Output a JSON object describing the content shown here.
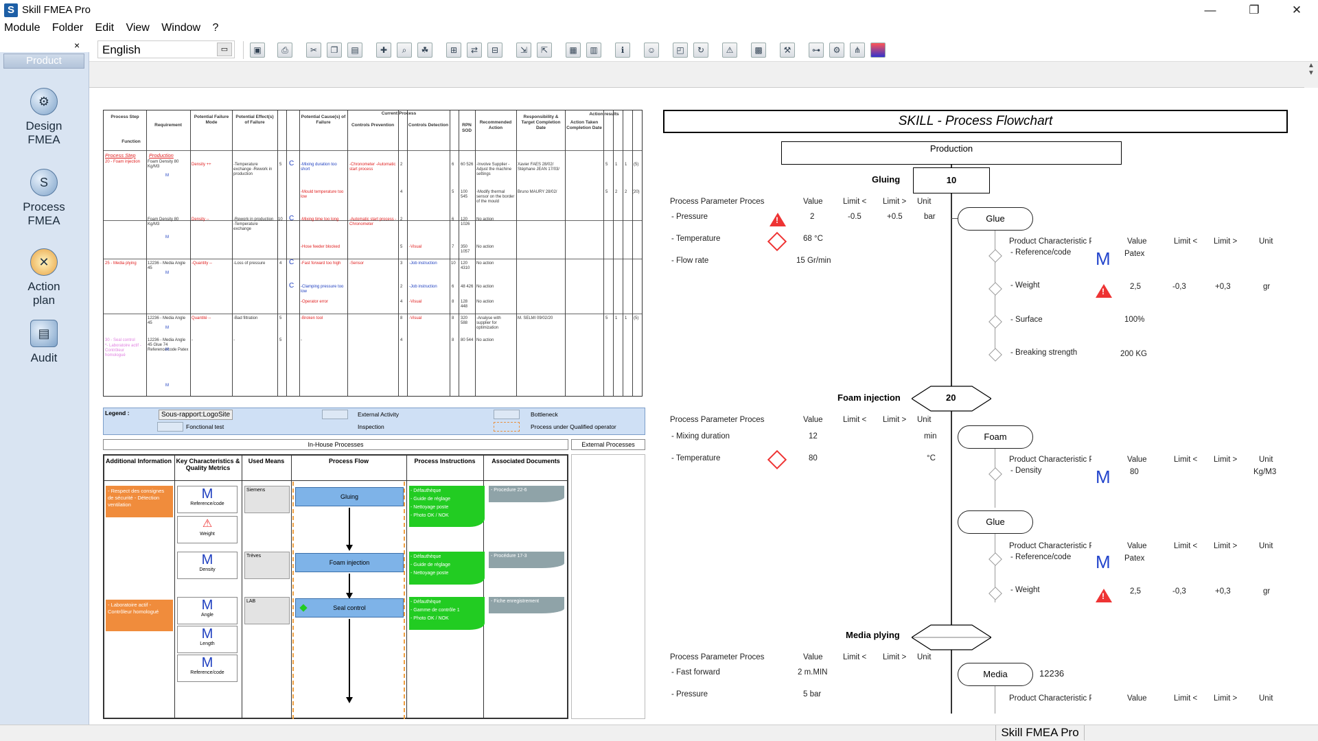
{
  "window": {
    "title": "Skill FMEA Pro",
    "controls": [
      "—",
      "❐",
      "✕"
    ]
  },
  "menu": [
    "Module",
    "Folder",
    "Edit",
    "View",
    "Window",
    "?"
  ],
  "toolbar": {
    "language": "English"
  },
  "leftpanel": {
    "close": "×",
    "tab": "Product",
    "items": [
      {
        "label": "Design",
        "label2": "FMEA"
      },
      {
        "label": "Process",
        "label2": "FMEA"
      },
      {
        "label": "Action",
        "label2": "plan"
      },
      {
        "label": "Audit",
        "label2": ""
      }
    ]
  },
  "status": "Skill FMEA Pro",
  "fmea": {
    "headers": [
      "Process Step",
      "Function",
      "Requirement",
      "Potential Failure Mode",
      "Potential Effect(s) of Failure",
      "Severity",
      "Classification",
      "Potential Cause(s) of Failure",
      "Current Process",
      "Controls Prevention",
      "Occurrency",
      "Controls Detection",
      "Detection",
      "RPN SOD",
      "Recommended Action",
      "Responsibility & Target Completion Date",
      "Action results",
      "Action Taken Completion Date",
      "Severity",
      "Occurrency",
      "Detection",
      "RPN"
    ],
    "step_label": "Process Step",
    "function_label": "Production",
    "rows": [
      {
        "step": "20 - Foam injection",
        "req": "Foam Density 80 Kg/M3",
        "mode": "Density ++",
        "effect": "-Temperature exchange -Rework in production",
        "sev": "5",
        "cls": "C",
        "cause": "-Mixing duration too short",
        "prev": "-Chronometer -Automatic start process",
        "occ": "2",
        "det": "6",
        "rpn": "60 526",
        "action": "-Involve Supplier -Adjust the machine settings",
        "resp": "Xavier FAES 28/02/ Stéphane JEAN 17/03/",
        "s": "5",
        "o": "1",
        "d": "1",
        "r": "(5)"
      },
      {
        "cause": "-Mould temperature too low",
        "occ": "4",
        "det": "5",
        "rpn": "100 545",
        "action": "-Modify thermal sensor on the border of the mould",
        "resp": "Bruno MAURY 28/02/",
        "s": "5",
        "o": "2",
        "d": "2",
        "r": "(20)"
      },
      {
        "req": "Foam Density 80 Kg/M3",
        "mode": "Density --",
        "effect": "-Rework in production -Temperature exchange",
        "sev": "10",
        "cls": "C",
        "cause": "-Mixing time too long",
        "prev": "-Automatic start process -Chronometer",
        "occ": "2",
        "det": "6",
        "rpn": "120 1026",
        "action": "No action"
      },
      {
        "cause": "-Hose feeder blocked",
        "prev_det": "-Visual",
        "occ": "5",
        "det": "7",
        "rpn": "350 1057",
        "action": "No action"
      },
      {
        "step": "25 - Media plying",
        "req": "12236 - Media Angle 45",
        "mode": "-Quantity --",
        "effect": "-Loss of pressure",
        "sev": "4",
        "cls": "C",
        "cause": "-Fast forward too high",
        "prev": "-Sensor",
        "occ": "3",
        "det_t": "-Job instruction",
        "det": "10",
        "rpn": "120 4310",
        "action": "No action"
      },
      {
        "cls": "C",
        "cause": "-Clamping pressure too low",
        "occ": "2",
        "det_t": "-Job instruction",
        "det": "6",
        "rpn": "48 426",
        "action": "No action"
      },
      {
        "cause": "-Operator error",
        "occ": "4",
        "det_t": "-Visual",
        "det": "8",
        "rpn": "128 448",
        "action": "No action"
      },
      {
        "req": "12236 - Media Angle 45",
        "mode": "Quantité --",
        "effect": "-Bad filtration",
        "sev": "5",
        "cause": "-Broken tool",
        "occ": "8",
        "det_t": "-Visual",
        "det": "8",
        "rpn": "320 588",
        "action": "-Analyse with supplier for optimization",
        "resp": "M. SELMI 09/02/20",
        "s": "5",
        "o": "1",
        "d": "1",
        "r": "(5)"
      },
      {
        "step": "30 - Seal control",
        "step2": "*- Laboratoire actif - Contrôleur homologué",
        "req": "12236 - Media Angle 45 Glue 74 Reference/code Patex",
        "mode": "-",
        "effect": "-",
        "sev": "5",
        "cause": "-",
        "occ": "4",
        "det": "8",
        "rpn": "80 544",
        "action": "No action"
      }
    ]
  },
  "legend": {
    "title": "Legend :",
    "subreport": "Sous-rapport:LogoSite",
    "functional": "Fonctional test",
    "external": "External Activity",
    "inspection": "Inspection",
    "bottleneck": "Bottleneck",
    "qualified": "Process under Qualified operator"
  },
  "flowsheet": {
    "inhouse": "In-House Processes",
    "external": "External Processes",
    "headers": [
      "Additional Information",
      "Key Characteristics & Quality Metrics",
      "Used Means",
      "Process Flow",
      "Process Instructions",
      "Associated Documents"
    ],
    "info1": "- Respect des consignes de sécurité - Détection ventilation",
    "info2": "- Laboratoire actif - Contrôleur homologué",
    "keys": [
      "Reference/code",
      "Weight",
      "Density",
      "Angle",
      "Length",
      "Reference/code"
    ],
    "means": [
      "Siemens",
      "Trèves",
      "LAB"
    ],
    "steps": [
      "Gluing",
      "Foam injection",
      "Seal control"
    ],
    "instr1": [
      "- Défauthèque",
      "- Guide de réglage",
      "- Nettoyage poste",
      "- Photo OK / NOK"
    ],
    "instr2": [
      "- Défauthèque",
      "- Guide de réglage",
      "- Nettoyage poste"
    ],
    "instr3": [
      "- Défauthèque",
      "- Gamme de contrôle 1",
      "- Photo OK / NOK"
    ],
    "docs": [
      "- Procedure 22-6",
      "- Procédure 17-3",
      "- Fiche enregistrement"
    ],
    "m": "M"
  },
  "flowchart": {
    "title": "SKILL - Process Flowchart",
    "production": "Production",
    "pp_headers": [
      "Process Parameter Process",
      "Value",
      "Limit <",
      "Limit >",
      "Unit"
    ],
    "pc_headers": [
      "Product Characteristic Produ",
      "Value",
      "Limit <",
      "Limit >",
      "Unit"
    ],
    "gluing": {
      "name": "Gluing",
      "num": "10",
      "params": [
        {
          "n": "- Pressure",
          "v": "2",
          "l1": "-0.5",
          "l2": "+0.5",
          "u": "bar"
        },
        {
          "n": "- Temperature",
          "v": "68 °C"
        },
        {
          "n": "- Flow rate",
          "v": "15 Gr/min"
        }
      ],
      "node": "Glue",
      "chars": [
        {
          "n": "- Reference/code",
          "v": "Patex"
        },
        {
          "n": "- Weight",
          "v": "2,5",
          "l1": "-0,3",
          "l2": "+0,3",
          "u": "gr"
        },
        {
          "n": "- Surface",
          "v": "100%"
        },
        {
          "n": "- Breaking strength",
          "v": "200 KG"
        }
      ]
    },
    "foam": {
      "name": "Foam injection",
      "num": "20",
      "params": [
        {
          "n": "- Mixing duration",
          "v": "12",
          "u": "min"
        },
        {
          "n": "- Temperature",
          "v": "80",
          "u": "°C"
        }
      ],
      "node": "Foam",
      "chars": [
        {
          "n": "- Density",
          "v": "80",
          "u": "Kg/M3"
        }
      ],
      "node2": "Glue",
      "chars2": [
        {
          "n": "- Reference/code",
          "v": "Patex"
        },
        {
          "n": "- Weight",
          "v": "2,5",
          "l1": "-0,3",
          "l2": "+0,3",
          "u": "gr"
        }
      ]
    },
    "media": {
      "name": "Media plying",
      "params": [
        {
          "n": "- Fast forward",
          "v": "2 m.MIN"
        },
        {
          "n": "- Pressure",
          "v": "5 bar"
        }
      ],
      "node": "Media",
      "code": "12236"
    },
    "m": "M"
  }
}
